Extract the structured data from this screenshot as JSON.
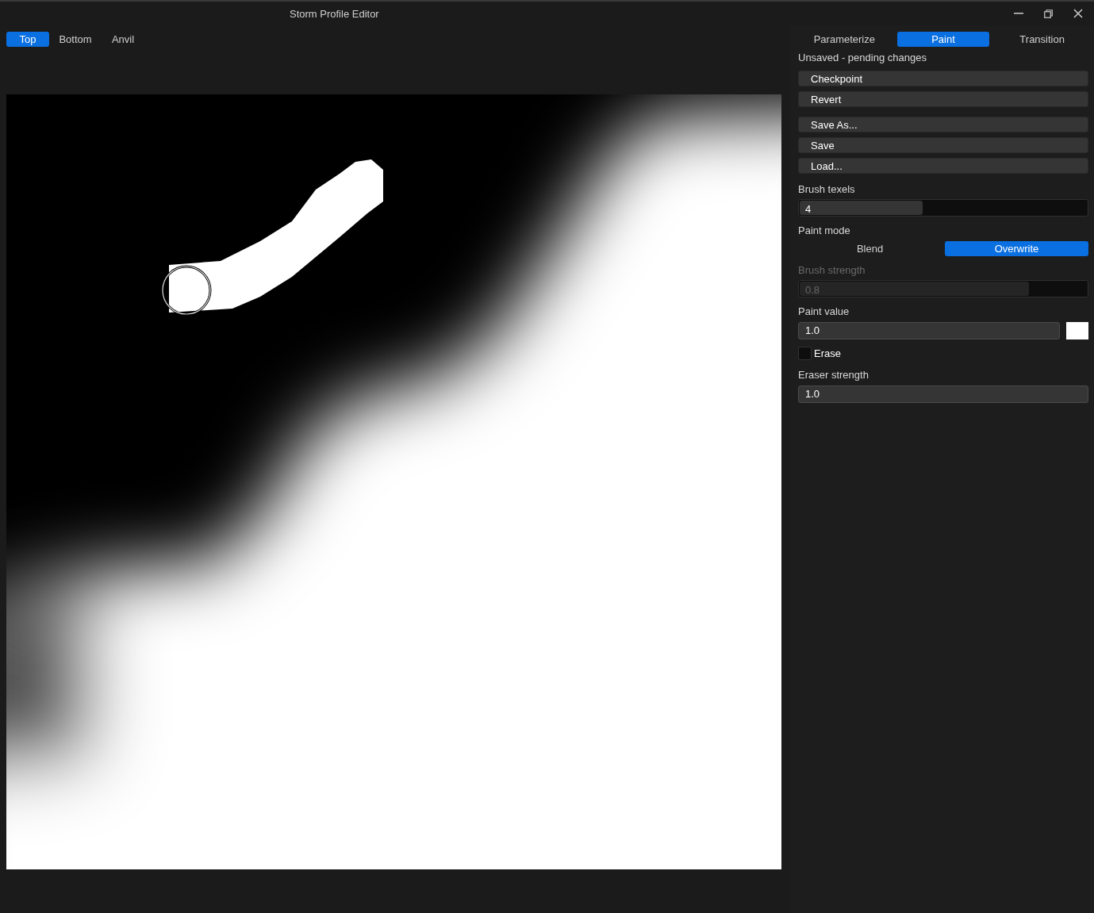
{
  "window": {
    "title": "Storm Profile Editor"
  },
  "view_tabs": [
    {
      "label": "Top",
      "selected": true
    },
    {
      "label": "Bottom",
      "selected": false
    },
    {
      "label": "Anvil",
      "selected": false
    }
  ],
  "mode_tabs": [
    {
      "label": "Parameterize",
      "selected": false
    },
    {
      "label": "Paint",
      "selected": true
    },
    {
      "label": "Transition",
      "selected": false
    }
  ],
  "status": "Unsaved - pending changes",
  "button_groups": [
    [
      "Checkpoint",
      "Revert"
    ],
    [
      "Save As...",
      "Save",
      "Load..."
    ]
  ],
  "brush_texels": {
    "label": "Brush texels",
    "value": "4",
    "level": 0.43
  },
  "paint_mode": {
    "label": "Paint mode",
    "options": [
      {
        "label": "Blend",
        "selected": false
      },
      {
        "label": "Overwrite",
        "selected": true
      }
    ]
  },
  "brush_strength": {
    "label": "Brush strength",
    "value": "0.8",
    "level": 0.8,
    "disabled": true
  },
  "paint_value": {
    "label": "Paint value",
    "value": "1.0",
    "color": "#ffffff"
  },
  "erase": {
    "label": "Erase",
    "checked": false
  },
  "eraser_strength": {
    "label": "Eraser strength",
    "value": "1.0"
  }
}
